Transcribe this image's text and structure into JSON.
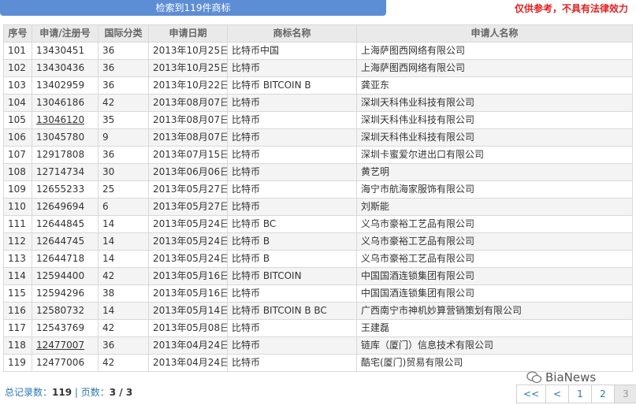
{
  "banner": {
    "label": "检索到119件商标"
  },
  "disclaimer": "仅供参考，不具有法律效力",
  "table": {
    "headers": [
      "序号",
      "申请/注册号",
      "国际分类",
      "申请日期",
      "商标名称",
      "申请人名称"
    ],
    "rows": [
      {
        "no": "101",
        "reg": "13430451",
        "cls": "36",
        "date": "2013年10月25日",
        "mark": "比特币中国",
        "applicant": "上海萨图西网络有限公司"
      },
      {
        "no": "102",
        "reg": "13430436",
        "cls": "36",
        "date": "2013年10月25日",
        "mark": "比特币",
        "applicant": "上海萨图西网络有限公司"
      },
      {
        "no": "103",
        "reg": "13402959",
        "cls": "36",
        "date": "2013年10月22日",
        "mark": "比特币 BITCOIN B",
        "applicant": "龚亚东"
      },
      {
        "no": "104",
        "reg": "13046186",
        "cls": "42",
        "date": "2013年08月07日",
        "mark": "比特币",
        "applicant": "深圳天科伟业科技有限公司"
      },
      {
        "no": "105",
        "reg": "13046120",
        "cls": "35",
        "date": "2013年08月07日",
        "mark": "比特币",
        "applicant": "深圳天科伟业科技有限公司"
      },
      {
        "no": "106",
        "reg": "13045780",
        "cls": "9",
        "date": "2013年08月07日",
        "mark": "比特币",
        "applicant": "深圳天科伟业科技有限公司"
      },
      {
        "no": "107",
        "reg": "12917808",
        "cls": "36",
        "date": "2013年07月15日",
        "mark": "比特币",
        "applicant": "深圳卡蜜爱尔进出口有限公司"
      },
      {
        "no": "108",
        "reg": "12714734",
        "cls": "30",
        "date": "2013年06月06日",
        "mark": "比特币",
        "applicant": "黄艺明"
      },
      {
        "no": "109",
        "reg": "12655233",
        "cls": "25",
        "date": "2013年05月27日",
        "mark": "比特币",
        "applicant": "海宁市航海家服饰有限公司"
      },
      {
        "no": "110",
        "reg": "12649694",
        "cls": "6",
        "date": "2013年05月27日",
        "mark": "比特币",
        "applicant": "刘斯能"
      },
      {
        "no": "111",
        "reg": "12644845",
        "cls": "14",
        "date": "2013年05月24日",
        "mark": "比特币 BC",
        "applicant": "义乌市豪裕工艺品有限公司"
      },
      {
        "no": "112",
        "reg": "12644745",
        "cls": "14",
        "date": "2013年05月24日",
        "mark": "比特币 B",
        "applicant": "义乌市豪裕工艺品有限公司"
      },
      {
        "no": "113",
        "reg": "12644718",
        "cls": "14",
        "date": "2013年05月24日",
        "mark": "比特币 B",
        "applicant": "义乌市豪裕工艺品有限公司"
      },
      {
        "no": "114",
        "reg": "12594400",
        "cls": "42",
        "date": "2013年05月16日",
        "mark": "比特币 BITCOIN",
        "applicant": "中国国酒连锁集团有限公司"
      },
      {
        "no": "115",
        "reg": "12594296",
        "cls": "38",
        "date": "2013年05月16日",
        "mark": "比特币",
        "applicant": "中国国酒连锁集团有限公司"
      },
      {
        "no": "116",
        "reg": "12580732",
        "cls": "14",
        "date": "2013年05月14日",
        "mark": "比特币 BITCOIN B BC",
        "applicant": "广西南宁市神机妙算营销策划有限公司"
      },
      {
        "no": "117",
        "reg": "12543769",
        "cls": "42",
        "date": "2013年05月08日",
        "mark": "比特币",
        "applicant": "王建磊"
      },
      {
        "no": "118",
        "reg": "12477007",
        "cls": "36",
        "date": "2013年04月24日",
        "mark": "比特币",
        "applicant": "链库（厦门）信息技术有限公司"
      },
      {
        "no": "119",
        "reg": "12477006",
        "cls": "42",
        "date": "2013年04月24日",
        "mark": "比特币",
        "applicant": "酷宅(厦门)贸易有限公司"
      }
    ]
  },
  "footer": {
    "total_label": "总记录数：",
    "total": "119",
    "sep": " | ",
    "pages_label": "页数：",
    "pages": "3 / 3"
  },
  "pager": [
    "<<",
    "<",
    "1",
    "2",
    "3"
  ],
  "watermark": "BiaNews",
  "colors": {
    "banner": "#5d8ed5",
    "link": "#2a76b8",
    "disclaimer": "#e02020"
  }
}
